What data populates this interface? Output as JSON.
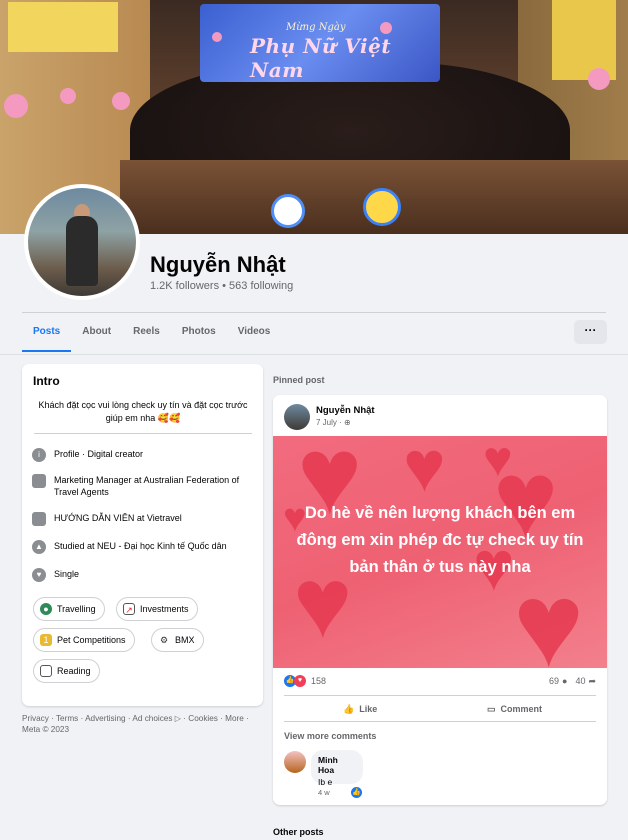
{
  "cover": {
    "banner_text": "Phụ Nữ Việt Nam",
    "banner_subtext": "Mừng Ngày"
  },
  "profile": {
    "name": "Nguyễn Nhật",
    "stats": "1.2K followers • 563 following"
  },
  "tabs": [
    {
      "label": "Posts",
      "active": true
    },
    {
      "label": "About"
    },
    {
      "label": "Reels"
    },
    {
      "label": "Photos"
    },
    {
      "label": "Videos"
    }
  ],
  "more_label": "···",
  "intro": {
    "title": "Intro",
    "bio": "Khách đặt cọc vui lòng check uy tín và đặt cọc trước giúp em nha 🥰🥰",
    "items": [
      {
        "icon": "info-icon",
        "text": "Profile · Digital creator"
      },
      {
        "icon": "briefcase-icon",
        "text": "Marketing Manager at Australian Federation of Travel Agents"
      },
      {
        "icon": "briefcase-icon",
        "text": "HƯỚNG DẪN VIÊN at Vietravel"
      },
      {
        "icon": "graduation-cap-icon",
        "text": "Studied at NEU - Đại học Kinh tế Quốc dân"
      },
      {
        "icon": "heart-icon",
        "text": "Single"
      }
    ],
    "hobbies": [
      {
        "icon": "globe-icon",
        "label": "Travelling"
      },
      {
        "icon": "chart-icon",
        "label": "Investments"
      },
      {
        "icon": "medal-icon",
        "label": "Pet Competitions"
      },
      {
        "icon": "bicycle-icon",
        "label": "BMX"
      },
      {
        "icon": "book-icon",
        "label": "Reading"
      }
    ]
  },
  "footer": "Privacy · Terms · Advertising · Ad choices ▷ · Cookies · More · Meta © 2023",
  "pinned": {
    "label": "Pinned post",
    "author": "Nguyễn Nhật",
    "date": "7 July · ",
    "text": "Do hè về nên lượng khách bên em đông em xin phép đc tự check uy tín bản thân ở tus này nha",
    "reactions": "158",
    "comments": "69",
    "shares": "40",
    "like_label": "Like",
    "comment_label": "Comment",
    "view_more": "View more comments",
    "comment": {
      "name": "Minh Hoa",
      "text": "Ib e",
      "time": "4 w"
    }
  },
  "other_posts_label": "Other posts",
  "colors": {
    "accent": "#1877f2",
    "post_bg": "#ee6173",
    "page_bg": "#f0f2f5"
  }
}
